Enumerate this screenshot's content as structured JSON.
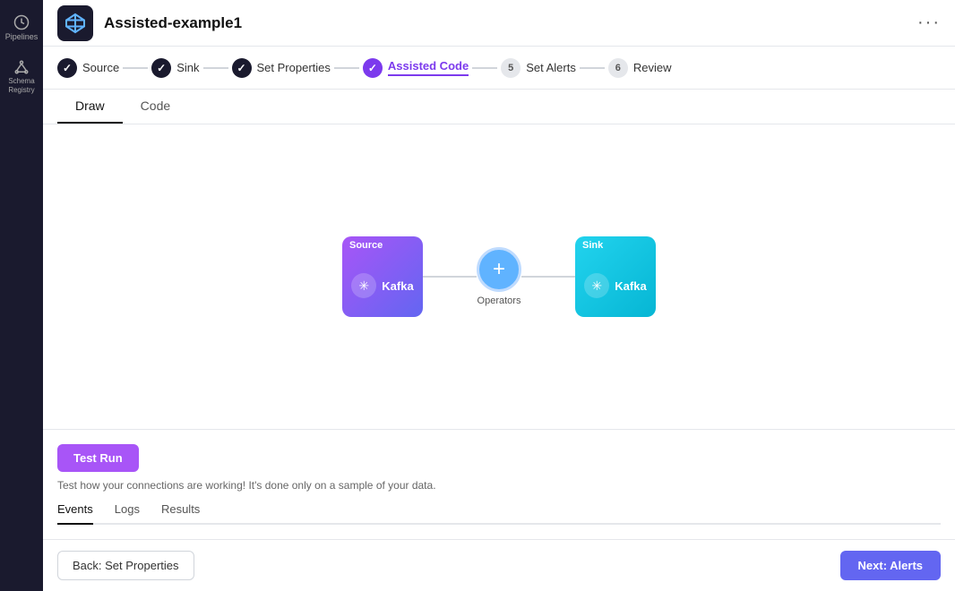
{
  "app": {
    "title": "Assisted-example1",
    "more_icon": "···"
  },
  "sidebar": {
    "items": [
      {
        "id": "pipelines",
        "label": "Pipelines",
        "icon": "clock"
      },
      {
        "id": "schema-registry",
        "label": "Schema Registry",
        "icon": "network"
      }
    ]
  },
  "stepper": {
    "steps": [
      {
        "id": "source",
        "label": "Source",
        "state": "done",
        "number": "✓"
      },
      {
        "id": "sink",
        "label": "Sink",
        "state": "done",
        "number": "✓"
      },
      {
        "id": "set-properties",
        "label": "Set Properties",
        "state": "done",
        "number": "✓"
      },
      {
        "id": "assisted-code",
        "label": "Assisted Code",
        "state": "active",
        "number": "✓"
      },
      {
        "id": "set-alerts",
        "label": "Set Alerts",
        "state": "numbered",
        "number": "5"
      },
      {
        "id": "review",
        "label": "Review",
        "state": "numbered",
        "number": "6"
      }
    ]
  },
  "view_tabs": {
    "tabs": [
      {
        "id": "draw",
        "label": "Draw",
        "active": true
      },
      {
        "id": "code",
        "label": "Code",
        "active": false
      }
    ]
  },
  "pipeline": {
    "source": {
      "header": "Source",
      "label": "Kafka",
      "icon": "✳"
    },
    "operator": {
      "icon": "+",
      "label": "Operators"
    },
    "sink": {
      "header": "Sink",
      "label": "Kafka",
      "icon": "✳"
    }
  },
  "test_run": {
    "button_label": "Test Run",
    "description": "Test how your connections are working! It's done only on a sample of your data."
  },
  "bottom_tabs": {
    "tabs": [
      {
        "id": "events",
        "label": "Events",
        "active": true
      },
      {
        "id": "logs",
        "label": "Logs",
        "active": false
      },
      {
        "id": "results",
        "label": "Results",
        "active": false
      }
    ]
  },
  "footer": {
    "back_label": "Back: Set Properties",
    "next_label": "Next: Alerts"
  }
}
